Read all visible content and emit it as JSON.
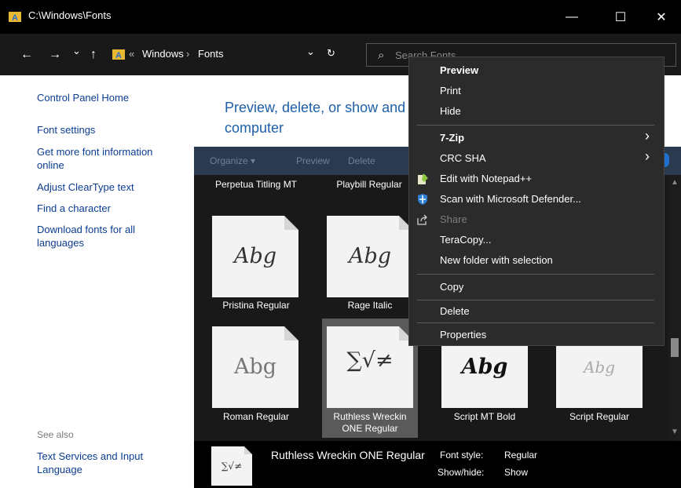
{
  "window": {
    "title": "C:\\Windows\\Fonts",
    "minimize": "—",
    "maximize": "☐",
    "close": "✕"
  },
  "nav": {
    "back": "←",
    "forward": "→",
    "recent": "⌄",
    "up": "↑",
    "path_sep": "«",
    "crumb1": "Windows",
    "crumb_arrow": "›",
    "crumb2": "Fonts",
    "dropdown": "⌄",
    "refresh": "↻",
    "search_icon": "⌕",
    "search_placeholder": "Search Fonts"
  },
  "sidebar": {
    "control_panel_home": "Control Panel Home",
    "font_settings": "Font settings",
    "more_info": "Get more font information online",
    "cleartype": "Adjust ClearType text",
    "find_char": "Find a character",
    "download": "Download fonts for all languages",
    "see_also": "See also",
    "text_services": "Text Services and Input Language"
  },
  "main": {
    "heading": "Preview, delete, or show and computer",
    "toolbar": {
      "organize": "Organize ▾",
      "preview": "Preview",
      "delete": "Delete"
    }
  },
  "fonts": {
    "perpetua": "Perpetua Titling MT",
    "playbill": "Playbill Regular",
    "pristina": "Pristina Regular",
    "pristina_sample": "Abg",
    "rage": "Rage Italic",
    "rage_sample": "Abg",
    "roman": "Roman Regular",
    "roman_sample": "Abg",
    "ruthless": "Ruthless Wreckin ONE Regular",
    "ruthless_sample": "∑√≠",
    "scriptmt": "Script MT Bold",
    "scriptmt_sample": "Abg",
    "script": "Script Regular",
    "script_sample": "Abg"
  },
  "details": {
    "sample": "∑√≠",
    "name": "Ruthless Wreckin ONE Regular",
    "style_label": "Font style:",
    "style_value": "Regular",
    "showhide_label": "Show/hide:",
    "showhide_value": "Show"
  },
  "context_menu": {
    "preview": "Preview",
    "print": "Print",
    "hide": "Hide",
    "sevenzip": "7-Zip",
    "crcsha": "CRC SHA",
    "notepad": "Edit with Notepad++",
    "defender": "Scan with Microsoft Defender...",
    "share": "Share",
    "teracopy": "TeraCopy...",
    "newfolder": "New folder with selection",
    "copy": "Copy",
    "delete": "Delete",
    "properties": "Properties",
    "submenu_arrow": "›"
  },
  "colors": {
    "accent": "#1d5fa8",
    "link": "#0b3d91",
    "menu_bg": "#2b2b2b"
  }
}
